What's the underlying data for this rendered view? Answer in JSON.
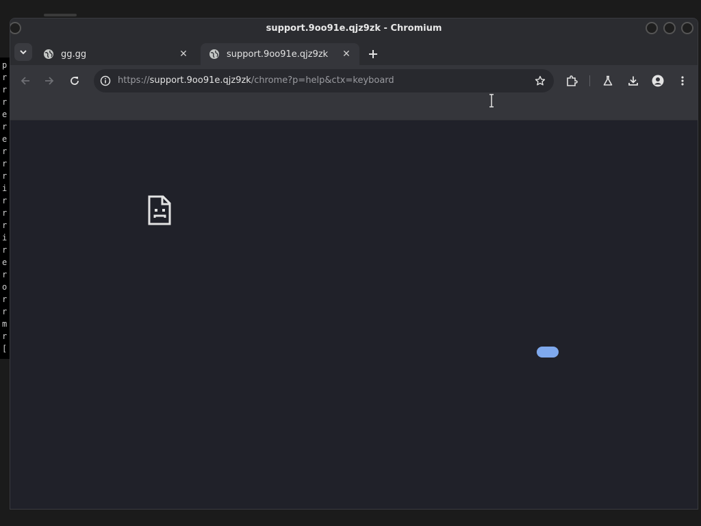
{
  "window": {
    "title": "support.9oo91e.qjz9zk - Chromium"
  },
  "tabs": [
    {
      "label": "gg.gg",
      "active": false
    },
    {
      "label": "support.9oo91e.qjz9zk",
      "active": true
    }
  ],
  "omnibox": {
    "url_scheme": "https://",
    "url_host": "support.9oo91e.qjz9zk",
    "url_path": "/chrome?p=help&ctx=keyboard"
  },
  "terminal_lines": [
    "p",
    "r",
    "r",
    "r",
    "e",
    "r",
    "e",
    "r",
    "r",
    "r",
    "i",
    "r",
    "r",
    "r",
    "i",
    "r",
    "e",
    "r",
    "o",
    "r",
    "r",
    "m",
    "r",
    "["
  ],
  "colors": {
    "accent": "#7fa9ed",
    "content_bg": "#202129",
    "toolbar_bg": "#35363b"
  }
}
